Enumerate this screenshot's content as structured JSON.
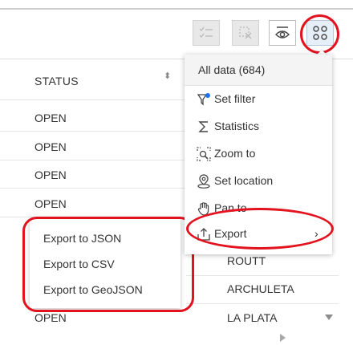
{
  "toolbar": {
    "buttons": [
      {
        "name": "select-all-icon",
        "state": "disabled"
      },
      {
        "name": "clear-selection-icon",
        "state": "disabled"
      },
      {
        "name": "toggle-visibility-icon",
        "state": "enabled"
      },
      {
        "name": "options-menu-icon",
        "state": "active"
      }
    ]
  },
  "table": {
    "status_header": "STATUS",
    "sort_icon": "⬍",
    "status_rows": [
      "OPEN",
      "OPEN",
      "OPEN",
      "OPEN",
      "OPEN"
    ],
    "county_rows": [
      "ROUTT",
      "ARCHULETA",
      "LA PLATA"
    ]
  },
  "menu": {
    "header": "All data (684)",
    "items": [
      {
        "label": "Set filter",
        "icon": "filter-icon"
      },
      {
        "label": "Statistics",
        "icon": "sigma-icon"
      },
      {
        "label": "Zoom to",
        "icon": "zoom-to-icon"
      },
      {
        "label": "Set location",
        "icon": "location-icon"
      },
      {
        "label": "Pan to",
        "icon": "pan-hand-icon"
      },
      {
        "label": "Export",
        "icon": "export-icon",
        "chevron": "›"
      }
    ]
  },
  "submenu": {
    "items": [
      "Export to JSON",
      "Export to CSV",
      "Export to GeoJSON"
    ]
  },
  "colors": {
    "highlight_ring": "#e2121f",
    "filter_dot": "#1f73e8",
    "active_button_bg": "#e6eef7"
  }
}
